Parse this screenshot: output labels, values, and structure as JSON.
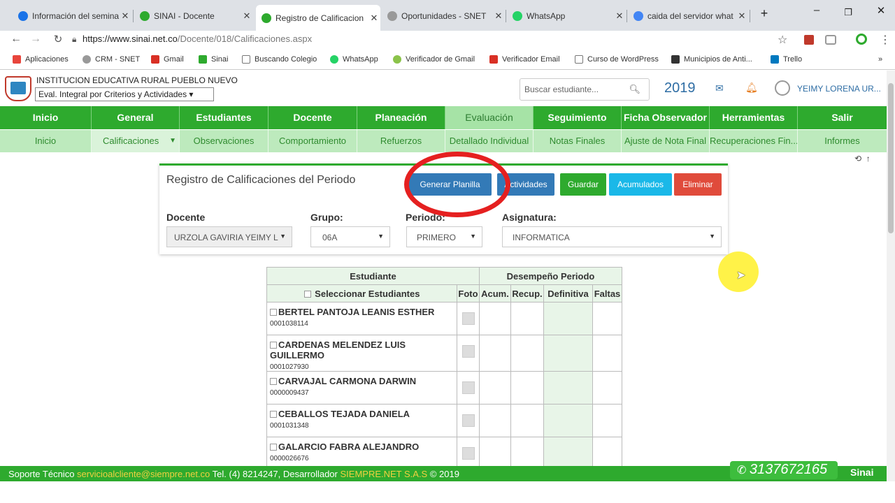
{
  "browser": {
    "tabs": [
      {
        "label": "Información del semina",
        "color": "#1a73e8"
      },
      {
        "label": "SINAI - Docente",
        "color": "#2eaa2e"
      },
      {
        "label": "Registro de Calificacion",
        "color": "#2eaa2e"
      },
      {
        "label": "Oportunidades - SNET",
        "color": "#999999"
      },
      {
        "label": "WhatsApp",
        "color": "#25d366"
      },
      {
        "label": "caida del servidor what",
        "color": "#4285f4"
      }
    ],
    "new_tab": "+",
    "url_host": "https://www.sinai.net.co",
    "url_path": "/Docente/018/Calificaciones.aspx",
    "bookmarks": [
      {
        "label": "Aplicaciones",
        "color": "#e8453c"
      },
      {
        "label": "CRM - SNET",
        "color": "#999999"
      },
      {
        "label": "Gmail",
        "color": "#d93025"
      },
      {
        "label": "Sinai",
        "color": "#2eaa2e"
      },
      {
        "label": "Buscando Colegio",
        "color": "#777777"
      },
      {
        "label": "WhatsApp",
        "color": "#25d366"
      },
      {
        "label": "Verificador de Gmail",
        "color": "#8bc34a"
      },
      {
        "label": "Verificador Email",
        "color": "#d93025"
      },
      {
        "label": "Curso de WordPress",
        "color": "#777777"
      },
      {
        "label": "Municipios de Anti...",
        "color": "#333333"
      },
      {
        "label": "Trello",
        "color": "#0079bf"
      }
    ],
    "more": "»"
  },
  "header": {
    "institution": "INSTITUCION EDUCATIVA RURAL PUEBLO NUEVO",
    "mode_select": "Eval. Integral por Criterios y Actividades ▾",
    "search_placeholder": "Buscar estudiante...",
    "year": "2019",
    "user": "YEIMY LORENA UR..."
  },
  "main_menu": [
    "Inicio",
    "General",
    "Estudiantes",
    "Docente",
    "Planeación",
    "Evaluación",
    "Seguimiento",
    "Ficha Observador",
    "Herramientas",
    "Salir"
  ],
  "sub_menu": [
    "Inicio",
    "Calificaciones",
    "Observaciones",
    "Comportamiento",
    "Refuerzos",
    "Detallado Individual",
    "Notas Finales",
    "Ajuste de Nota Final",
    "Recuperaciones Fin...",
    "Informes"
  ],
  "sub_menu_caret": "▼",
  "panel": {
    "title": "Registro de Calificaciones del Periodo",
    "buttons": {
      "generar": "Generar Planilla",
      "actividades": "Actividades",
      "guardar": "Guardar",
      "acumulados": "Acumulados",
      "eliminar": "Eliminar"
    },
    "filters": {
      "docente_label": "Docente",
      "docente_value": "URZOLA GAVIRIA YEIMY L",
      "grupo_label": "Grupo:",
      "grupo_value": "06A",
      "periodo_label": "Periodo:",
      "periodo_value": "PRIMERO",
      "asignatura_label": "Asignatura:",
      "asignatura_value": "INFORMATICA"
    }
  },
  "table": {
    "head_estudiante": "Estudiante",
    "head_desempeno": "Desempeño Periodo",
    "select_all": "Seleccionar Estudiantes",
    "col_foto": "Foto",
    "col_acum": "Acum.",
    "col_recup": "Recup.",
    "col_definitiva": "Definitiva",
    "col_faltas": "Faltas",
    "students": [
      {
        "name": "BERTEL PANTOJA LEANIS ESTHER",
        "code": "0001038114"
      },
      {
        "name": "CARDENAS MELENDEZ LUIS GUILLERMO",
        "code": "0001027930"
      },
      {
        "name": "CARVAJAL CARMONA DARWIN",
        "code": "0000009437"
      },
      {
        "name": "CEBALLOS TEJADA DANIELA",
        "code": "0001031348"
      },
      {
        "name": "GALARCIO FABRA ALEJANDRO",
        "code": "0000026676"
      }
    ]
  },
  "footer": {
    "text1": "Soporte Técnico ",
    "email": "servicioalcliente@siempre.net.co",
    "text2": " Tel. (4) 8214247, Desarrollador ",
    "dev": "SIEMPRE.NET S.A.S",
    "text3": " © 2019",
    "phone": "3137672165",
    "brand": "Sinai"
  }
}
